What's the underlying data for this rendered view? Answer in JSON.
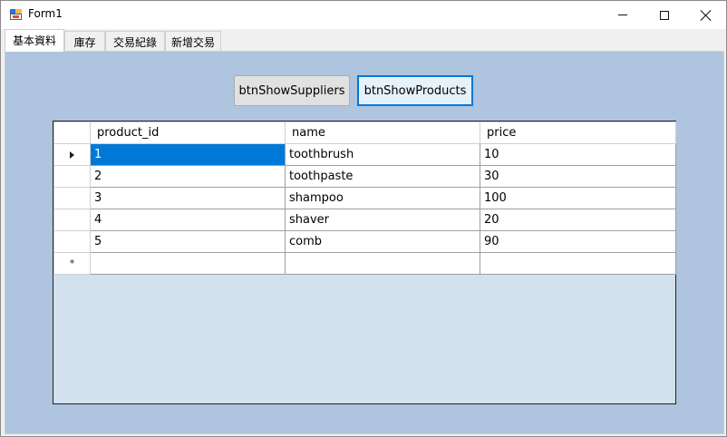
{
  "window": {
    "title": "Form1"
  },
  "tabs": [
    {
      "label": "基本資料"
    },
    {
      "label": "庫存"
    },
    {
      "label": "交易紀錄"
    },
    {
      "label": "新增交易"
    }
  ],
  "buttons": {
    "show_suppliers": "btnShowSuppliers",
    "show_products": "btnShowProducts"
  },
  "grid": {
    "columns": [
      "product_id",
      "name",
      "price"
    ],
    "rows": [
      [
        "1",
        "toothbrush",
        "10"
      ],
      [
        "2",
        "toothpaste",
        "30"
      ],
      [
        "3",
        "shampoo",
        "100"
      ],
      [
        "4",
        "shaver",
        "20"
      ],
      [
        "5",
        "comb",
        "90"
      ]
    ],
    "new_row_marker": "*"
  },
  "colors": {
    "tab_page_background": "#afc4de",
    "grid_background": "#d3e0ee",
    "selection": "#0078d7",
    "focused_button_border": "#0078d7"
  },
  "icons": {
    "app": "winforms-app-icon",
    "minimize": "minimize-icon",
    "maximize": "maximize-icon",
    "close": "close-icon",
    "current_row": "row-pointer-icon"
  }
}
